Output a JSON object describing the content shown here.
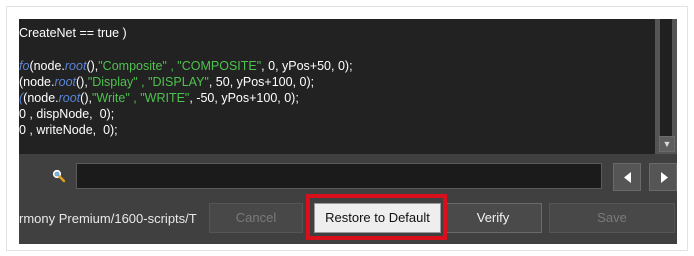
{
  "editor": {
    "lines": [
      [
        {
          "t": "CreateNet == true )",
          "c": "plain"
        }
      ],
      [],
      [
        {
          "t": "fo",
          "c": "kw"
        },
        {
          "t": "(node.",
          "c": "plain"
        },
        {
          "t": "root",
          "c": "kw"
        },
        {
          "t": "(),",
          "c": "plain"
        },
        {
          "t": "\"Composite\" , \"COMPOSITE\"",
          "c": "str"
        },
        {
          "t": ", 0, yPos+50, 0);",
          "c": "plain"
        }
      ],
      [
        {
          "t": "(node.",
          "c": "plain"
        },
        {
          "t": "root",
          "c": "kw"
        },
        {
          "t": "(),",
          "c": "plain"
        },
        {
          "t": "\"Display\" , \"DISPLAY\"",
          "c": "str"
        },
        {
          "t": ", 50, yPos+100, 0);",
          "c": "plain"
        }
      ],
      [
        {
          "t": "(",
          "c": "kw"
        },
        {
          "t": "(node.",
          "c": "plain"
        },
        {
          "t": "root",
          "c": "kw"
        },
        {
          "t": "(),",
          "c": "plain"
        },
        {
          "t": "\"Write\" , \"WRITE\"",
          "c": "str"
        },
        {
          "t": ", -50, yPos+100, 0);",
          "c": "plain"
        }
      ],
      [
        {
          "t": "0 , dispNode,  0);",
          "c": "plain"
        }
      ],
      [
        {
          "t": "0 , writeNode,  0);",
          "c": "plain"
        }
      ]
    ]
  },
  "search": {
    "value": "",
    "placeholder": ""
  },
  "footer": {
    "path": "rmony Premium/1600-scripts/T",
    "cancel_label": "Cancel",
    "restore_label": "Restore to Default",
    "verify_label": "Verify",
    "save_label": "Save"
  },
  "colors": {
    "keyword": "#5a85d6",
    "string": "#4ec24e",
    "highlight": "#d9101c"
  },
  "icons": {
    "search": "search-icon",
    "prev": "arrow-left-icon",
    "next": "arrow-right-icon",
    "scroll_down": "chevron-down-icon"
  }
}
